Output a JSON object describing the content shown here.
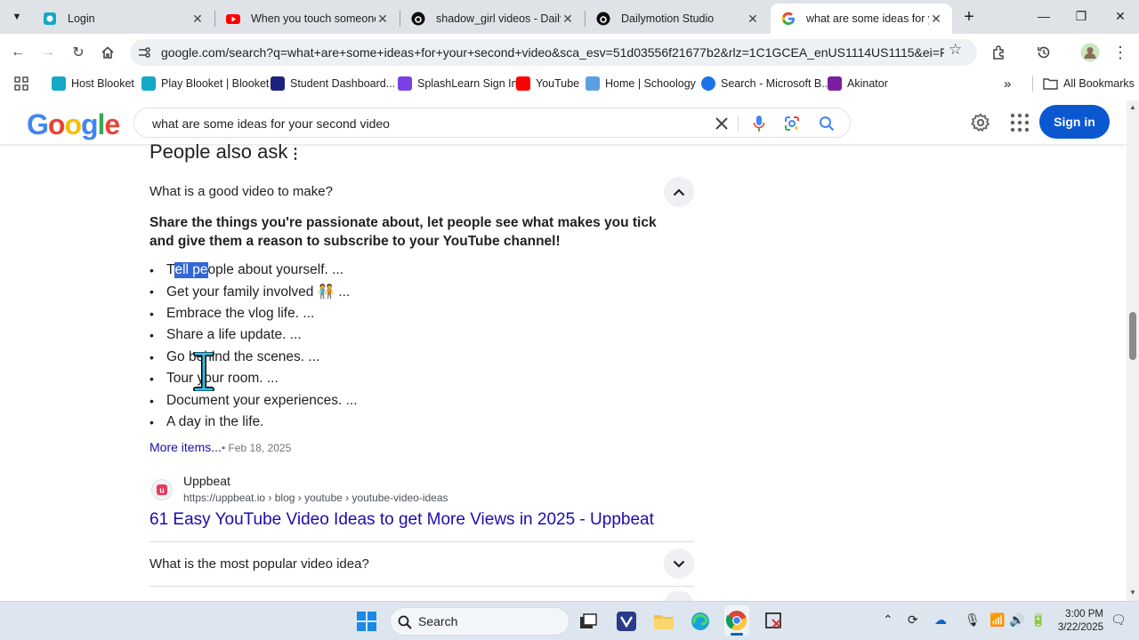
{
  "tabs": [
    {
      "title": "Login",
      "favicon": "blooket-icon",
      "active": false
    },
    {
      "title": "When you touch someone y",
      "favicon": "youtube-icon",
      "active": false
    },
    {
      "title": "shadow_girl videos - Dailym",
      "favicon": "dailymotion-icon",
      "active": false
    },
    {
      "title": "Dailymotion Studio",
      "favicon": "dailymotion-icon",
      "active": false
    },
    {
      "title": "what are some ideas for you",
      "favicon": "google-icon",
      "active": true
    }
  ],
  "address_bar": {
    "url": "google.com/search?q=what+are+some+ideas+for+your+second+video&sca_esv=51d03556f21677b2&rlz=1C1GCEA_enUS1114US1115&ei=FBTfZ-S..."
  },
  "bookmarks": [
    {
      "label": "Host Blooket",
      "color": "#14a9c7"
    },
    {
      "label": "Play Blooket | Blooket",
      "color": "#14a9c7"
    },
    {
      "label": "Student Dashboard...",
      "color": "#1a237e"
    },
    {
      "label": "SplashLearn Sign In",
      "color": "#7b3fe4"
    },
    {
      "label": "YouTube",
      "color": "#ff0000"
    },
    {
      "label": "Home | Schoology",
      "color": "#5aa0e0"
    },
    {
      "label": "Search - Microsoft B...",
      "color": "#1a73e8"
    },
    {
      "label": "Akinator",
      "color": "#7b1fa2"
    }
  ],
  "all_bookmarks_label": "All Bookmarks",
  "google": {
    "logo_text": "Google",
    "query": "what are some ideas for your second video",
    "signin_label": "Sign in"
  },
  "paa": {
    "heading": "People also ask",
    "question1": "What is a good video to make?",
    "answer": "Share the things you're passionate about, let people see what makes you tick and give them a reason to subscribe to your YouTube channel!",
    "first_item": {
      "pre": "T",
      "selected": "ell pe",
      "post": "ople about yourself. ..."
    },
    "items": [
      "Get your family involved 🧑‍🤝‍🧑 ...",
      "Embrace the vlog life. ...",
      "Share a life update. ...",
      "Go behind the scenes. ...",
      "Tour your room. ...",
      "Document your experiences. ...",
      "A day in the life."
    ],
    "more_items": "More items...",
    "more_date": "Feb 18, 2025",
    "source_name": "Uppbeat",
    "source_url": "https://uppbeat.io › blog › youtube › youtube-video-ideas",
    "result_title": "61 Easy YouTube Video Ideas to get More Views in 2025 - Uppbeat",
    "question2": "What is the most popular video idea?"
  },
  "taskbar": {
    "search_label": "Search",
    "time": "3:00 PM",
    "date": "3/22/2025"
  }
}
